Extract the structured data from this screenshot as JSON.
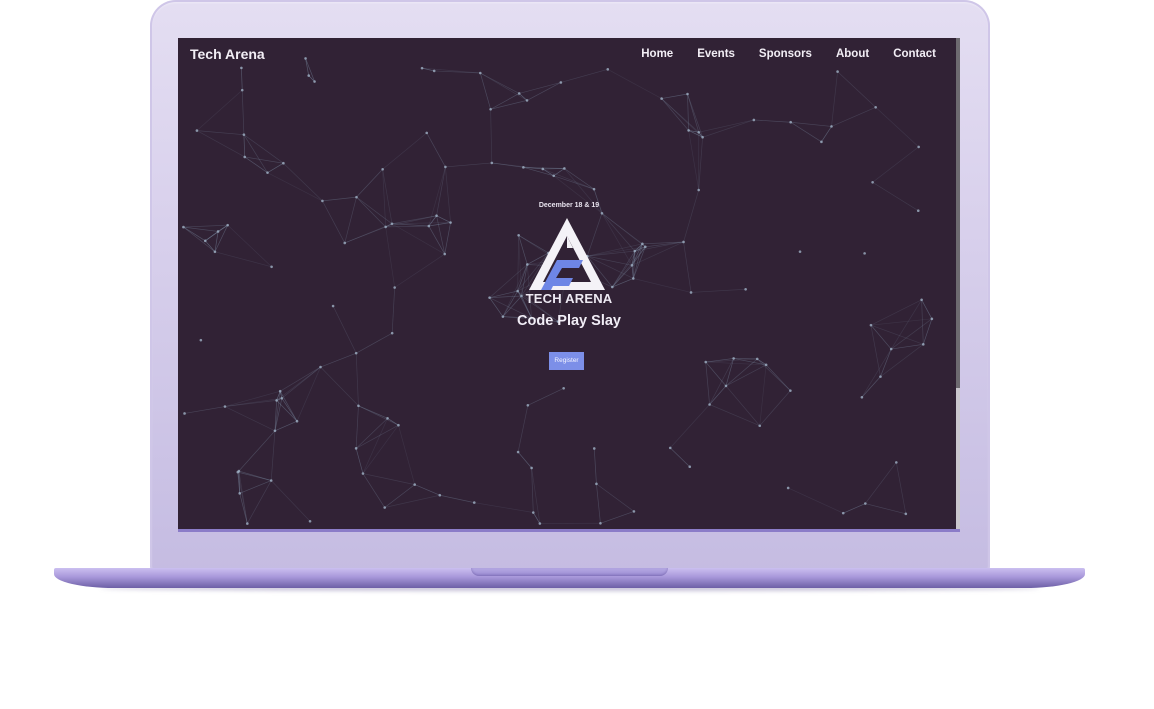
{
  "header": {
    "brand": "Tech Arena",
    "nav": [
      "Home",
      "Events",
      "Sponsors",
      "About",
      "Contact"
    ]
  },
  "hero": {
    "date": "December 18 & 19",
    "logo_text": "TECH ARENA",
    "tagline": "Code Play Slay",
    "register_label": "Register"
  },
  "colors": {
    "background": "#312235",
    "accent": "#7c8fe8",
    "laptop_frame": "#d8d0ec"
  }
}
